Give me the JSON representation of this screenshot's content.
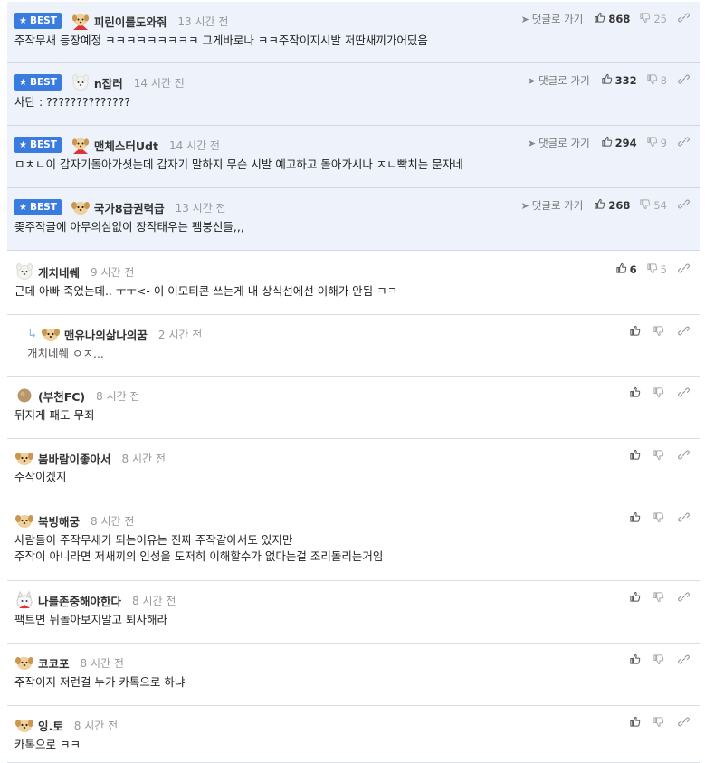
{
  "colors": {
    "best_bg": "#eef3fb",
    "badge": "#3a7be0",
    "divider": "#d9dde4"
  },
  "labels": {
    "best": "BEST",
    "goto": "댓글로 가기"
  },
  "comments": [
    {
      "best": true,
      "avatar": "puppy-red-icon",
      "nick": "피린이를도와줘",
      "time": "13 시간 전",
      "text": "주작무새 등장예정 ㅋㅋㅋㅋㅋㅋㅋㅋㅋ 그게바로나 ㅋㅋ주작이지시발 저딴새끼가어딨음",
      "goto": true,
      "up": "868",
      "down": "25"
    },
    {
      "best": true,
      "avatar": "white-dog-icon",
      "nick": "n잡러",
      "time": "14 시간 전",
      "text": "사탄 : ??????????????",
      "goto": true,
      "up": "332",
      "down": "8"
    },
    {
      "best": true,
      "avatar": "puppy-red-icon",
      "nick": "맨체스터Udt",
      "time": "14 시간 전",
      "text": "ㅁㅊㄴ이 갑자기돌아가셧는데 갑자기 말하지 무슨 시발 예고하고 돌아가시나 ㅈㄴ빡치는 문자네",
      "goto": true,
      "up": "294",
      "down": "9"
    },
    {
      "best": true,
      "avatar": "puppy-icon",
      "nick": "국가8급권력급",
      "time": "13 시간 전",
      "text": "좆주작글에 아무의심없이 장작태우는 펨붕신들,,,",
      "goto": true,
      "up": "268",
      "down": "54"
    },
    {
      "best": false,
      "avatar": "white-dog-icon",
      "nick": "개치네쒜",
      "time": "9 시간 전",
      "text": "근데 아빠 죽었는데.. ㅜㅜ<- 이 이모티콘 쓰는게 내 상식선에선 이해가 안됨 ㅋㅋ",
      "goto": false,
      "up": "6",
      "down": "5"
    },
    {
      "best": false,
      "reply": true,
      "avatar": "puppy-icon",
      "nick": "맨유나의삶나의꿈",
      "time": "2 시간 전",
      "text": "개치네쒜 ㅇㅈ...",
      "goto": false,
      "up": "",
      "down": ""
    },
    {
      "best": false,
      "avatar": "brown-circle-icon",
      "nick": "(부천FC)",
      "time": "8 시간 전",
      "text": "뒤지게 패도 무죄",
      "goto": false,
      "up": "",
      "down": ""
    },
    {
      "best": false,
      "avatar": "puppy-icon",
      "nick": "봄바람이좋아서",
      "time": "8 시간 전",
      "text": "주작이겠지",
      "goto": false,
      "up": "",
      "down": ""
    },
    {
      "best": false,
      "avatar": "puppy-icon",
      "nick": "북빙해궁",
      "time": "8 시간 전",
      "text": "사람들이 주작무새가 되는이유는 진짜 주작같아서도 있지만\n주작이 아니라면 저새끼의 인성을 도저히 이해할수가 없다는걸 조리돌리는거임",
      "goto": false,
      "up": "",
      "down": ""
    },
    {
      "best": false,
      "avatar": "cat-santa-icon",
      "nick": "나를존중해야한다",
      "time": "8 시간 전",
      "text": "팩트면 뒤돌아보지말고 퇴사해라",
      "goto": false,
      "up": "",
      "down": ""
    },
    {
      "best": false,
      "avatar": "puppy-icon",
      "nick": "코코포",
      "time": "8 시간 전",
      "text": "주작이지 저런걸 누가 카톡으로 하냐",
      "goto": false,
      "up": "",
      "down": ""
    },
    {
      "best": false,
      "avatar": "puppy-icon",
      "nick": "잉.토",
      "time": "8 시간 전",
      "text": "카톡으로 ㅋㅋ",
      "goto": false,
      "up": "",
      "down": ""
    }
  ]
}
